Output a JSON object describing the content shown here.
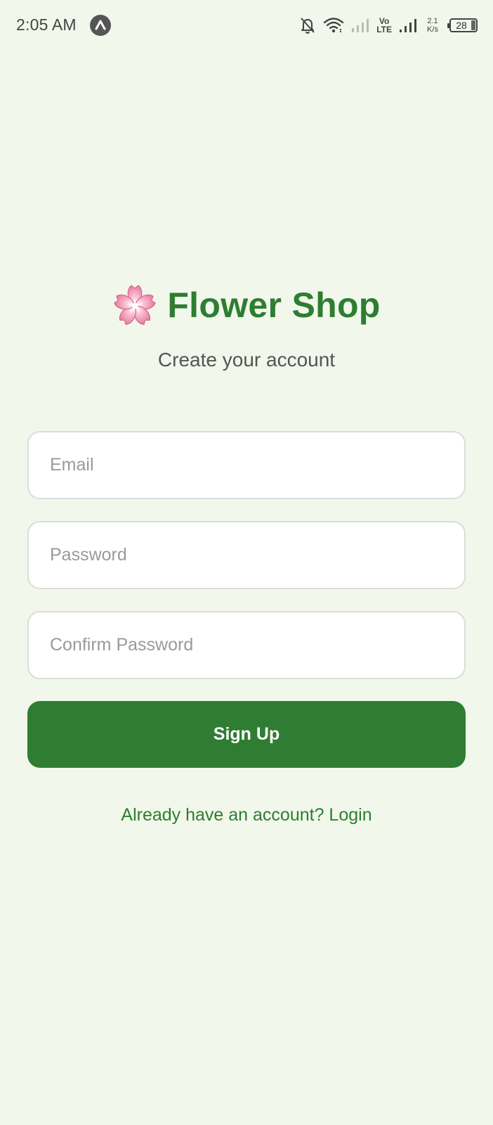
{
  "status_bar": {
    "time": "2:05 AM",
    "app_icon": "a-circle-icon",
    "network_speed_value": "2.1",
    "network_speed_unit": "K/s",
    "network_label_top": "Vo",
    "network_label_bottom": "LTE",
    "battery_level": "28"
  },
  "header": {
    "logo_icon": "cherry-blossom-icon",
    "title": "Flower Shop",
    "subtitle": "Create your account"
  },
  "form": {
    "email": {
      "value": "",
      "placeholder": "Email"
    },
    "password": {
      "value": "",
      "placeholder": "Password"
    },
    "confirm_password": {
      "value": "",
      "placeholder": "Confirm Password"
    },
    "submit_label": "Sign Up"
  },
  "footer": {
    "login_link": "Already have an account? Login"
  },
  "colors": {
    "background": "#F1F7EA",
    "primary": "#2E7D32",
    "input_border": "#DCDCDC",
    "placeholder": "#9A9A9A"
  }
}
